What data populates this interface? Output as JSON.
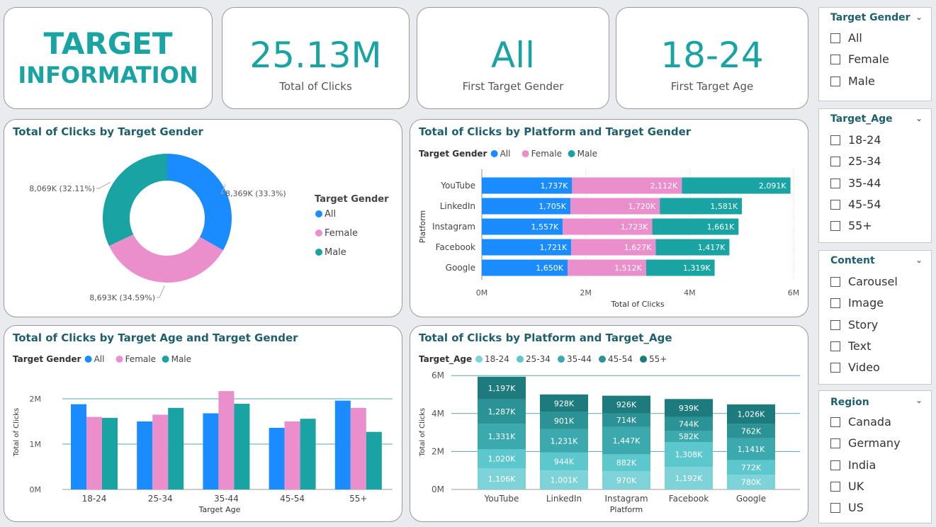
{
  "kpi": {
    "title_line1": "TARGET",
    "title_line2": "INFORMATION",
    "total_clicks_value": "25.13M",
    "total_clicks_label": "Total of Clicks",
    "first_gender_value": "All",
    "first_gender_label": "First Target Gender",
    "first_age_value": "18-24",
    "first_age_label": "First Target Age"
  },
  "colors": {
    "All": "#1a8cff",
    "Female": "#ea8fcb",
    "Male": "#1aa3a3",
    "age": [
      "#7dd3d8",
      "#5cc7cc",
      "#3ba9ad",
      "#2b9396",
      "#1e7b7d"
    ]
  },
  "slicers": [
    {
      "title": "Target Gender",
      "options": [
        "All",
        "Female",
        "Male"
      ]
    },
    {
      "title": "Target_Age",
      "options": [
        "18-24",
        "25-34",
        "35-44",
        "45-54",
        "55+"
      ]
    },
    {
      "title": "Content",
      "options": [
        "Carousel",
        "Image",
        "Story",
        "Text",
        "Video"
      ]
    },
    {
      "title": "Region",
      "options": [
        "Canada",
        "Germany",
        "India",
        "UK",
        "US"
      ]
    }
  ],
  "chart_data": [
    {
      "type": "pie",
      "title": "Total of Clicks by Target Gender",
      "legend_title": "Target Gender",
      "legend_position": "right",
      "slices": [
        {
          "name": "All",
          "label": "8,369K (33.3%)",
          "value": 8369
        },
        {
          "name": "Female",
          "label": "8,693K (34.59%)",
          "value": 8693
        },
        {
          "name": "Male",
          "label": "8,069K (32.11%)",
          "value": 8069
        }
      ]
    },
    {
      "type": "bar",
      "orientation": "horizontal",
      "stacked": true,
      "title": "Total of Clicks by Platform and Target Gender",
      "legend_title": "Target Gender",
      "legend_position": "top-left",
      "xlabel": "Total of Clicks",
      "ylabel": "Platform",
      "categories": [
        "YouTube",
        "LinkedIn",
        "Instagram",
        "Facebook",
        "Google"
      ],
      "xlim": [
        0,
        6
      ],
      "ticks": [
        "0M",
        "2M",
        "4M",
        "6M"
      ],
      "series": [
        {
          "name": "All",
          "values": [
            1737,
            1705,
            1557,
            1721,
            1650
          ],
          "labels": [
            "1,737K",
            "1,705K",
            "1,557K",
            "1,721K",
            "1,650K"
          ]
        },
        {
          "name": "Female",
          "values": [
            2112,
            1720,
            1723,
            1627,
            1512
          ],
          "labels": [
            "2,112K",
            "1,720K",
            "1,723K",
            "1,627K",
            "1,512K"
          ]
        },
        {
          "name": "Male",
          "values": [
            2091,
            1581,
            1661,
            1417,
            1319
          ],
          "labels": [
            "2,091K",
            "1,581K",
            "1,661K",
            "1,417K",
            "1,319K"
          ]
        }
      ]
    },
    {
      "type": "bar",
      "title": "Total of Clicks by Target Age and Target Gender",
      "legend_title": "Target Gender",
      "legend_position": "top-left",
      "xlabel": "Target Age",
      "ylabel": "Total of Clicks",
      "categories": [
        "18-24",
        "25-34",
        "35-44",
        "45-54",
        "55+"
      ],
      "ylim": [
        0,
        2.5
      ],
      "ticks": [
        "0M",
        "1M",
        "2M"
      ],
      "series": [
        {
          "name": "All",
          "values": [
            1.88,
            1.5,
            1.68,
            1.36,
            1.96
          ]
        },
        {
          "name": "Female",
          "values": [
            1.6,
            1.65,
            2.17,
            1.5,
            1.8
          ]
        },
        {
          "name": "Male",
          "values": [
            1.58,
            1.8,
            1.89,
            1.56,
            1.27
          ]
        }
      ]
    },
    {
      "type": "bar",
      "stacked": true,
      "title": "Total of Clicks by Platform and Target_Age",
      "legend_title": "Target_Age",
      "legend_position": "top-left",
      "xlabel": "Platform",
      "ylabel": "Total of Clicks",
      "categories": [
        "YouTube",
        "LinkedIn",
        "Instagram",
        "Facebook",
        "Google"
      ],
      "ylim": [
        0,
        6
      ],
      "ticks": [
        "0M",
        "2M",
        "4M",
        "6M"
      ],
      "series": [
        {
          "name": "18-24",
          "values": [
            1106,
            1001,
            970,
            1192,
            780
          ],
          "labels": [
            "1,106K",
            "1,001K",
            "970K",
            "1,192K",
            "780K"
          ]
        },
        {
          "name": "25-34",
          "values": [
            1020,
            944,
            882,
            1308,
            772
          ],
          "labels": [
            "1,020K",
            "944K",
            "882K",
            "1,308K",
            "772K"
          ]
        },
        {
          "name": "35-44",
          "values": [
            1331,
            1231,
            1447,
            582,
            1141
          ],
          "labels": [
            "1,331K",
            "1,231K",
            "1,447K",
            "582K",
            "1,141K"
          ]
        },
        {
          "name": "45-54",
          "values": [
            1287,
            901,
            714,
            744,
            762
          ],
          "labels": [
            "1,287K",
            "901K",
            "714K",
            "744K",
            "762K"
          ]
        },
        {
          "name": "55+",
          "values": [
            1197,
            928,
            926,
            939,
            1026
          ],
          "labels": [
            "1,197K",
            "928K",
            "926K",
            "939K",
            "1,026K"
          ]
        }
      ]
    }
  ]
}
